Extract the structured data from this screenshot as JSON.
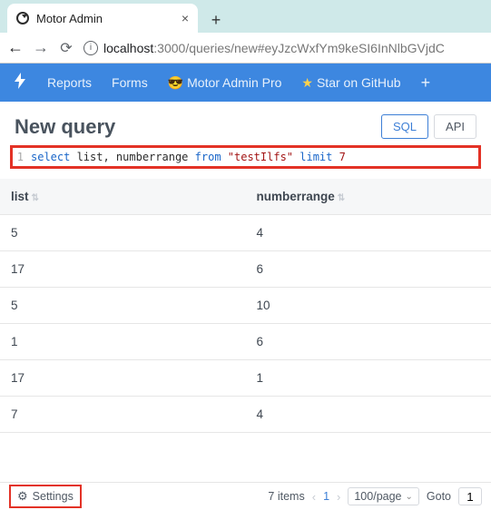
{
  "browser": {
    "tab_title": "Motor Admin",
    "url_host": "localhost",
    "url_port": ":3000",
    "url_path": "/queries/new#eyJzcWxfYm9keSI6InNlbGVjdC"
  },
  "nav": {
    "reports": "Reports",
    "forms": "Forms",
    "pro": "Motor Admin Pro",
    "star": "Star on GitHub"
  },
  "page": {
    "title": "New query",
    "sql_btn": "SQL",
    "api_btn": "API"
  },
  "sql": {
    "lineno": "1",
    "kw_select": "select",
    "cols": " list, numberrange ",
    "kw_from": "from",
    "tbl": " \"testIlfs\" ",
    "kw_limit": "limit",
    "num": " 7"
  },
  "table": {
    "headers": {
      "c0": "list",
      "c1": "numberrange"
    },
    "rows": [
      {
        "c0": "5",
        "c1": "4"
      },
      {
        "c0": "17",
        "c1": "6"
      },
      {
        "c0": "5",
        "c1": "10"
      },
      {
        "c0": "1",
        "c1": "6"
      },
      {
        "c0": "17",
        "c1": "1"
      },
      {
        "c0": "7",
        "c1": "4"
      }
    ]
  },
  "footer": {
    "settings": "Settings",
    "count": "7 items",
    "page": "1",
    "per_page": "100/page",
    "goto": "Goto",
    "goto_val": "1"
  }
}
